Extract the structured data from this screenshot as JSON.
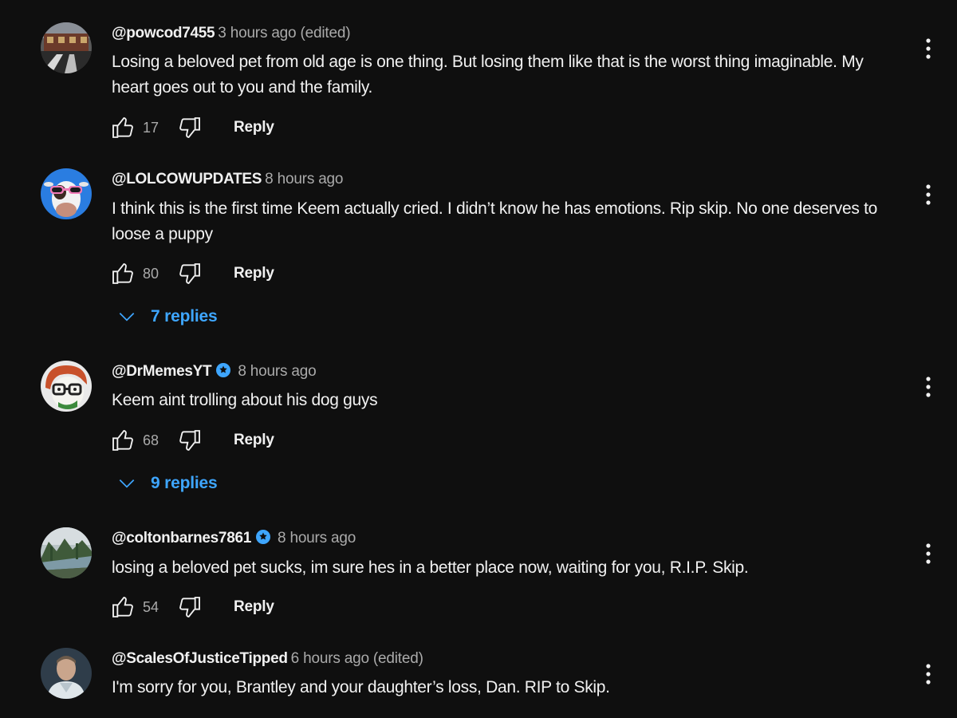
{
  "comments": [
    {
      "author": "@powcod7455",
      "verified": false,
      "timestamp": "3 hours ago (edited)",
      "text": "Losing a beloved pet from old age is one thing. But losing them like that is the worst thing imaginable. My heart goes out to you and the family.",
      "likes": "17",
      "reply_label": "Reply",
      "avatar_icon": "train-station-photo-avatar"
    },
    {
      "author": "@LOLCOWUPDATES",
      "verified": false,
      "timestamp": "8 hours ago",
      "text": "I think this is the first time Keem actually cried. I didn’t know he has emotions. Rip skip. No one deserves to loose a puppy",
      "likes": "80",
      "reply_label": "Reply",
      "replies_label": "7 replies",
      "avatar_icon": "cow-with-sunglasses-avatar"
    },
    {
      "author": "@DrMemesYT",
      "verified": true,
      "timestamp": "8 hours ago",
      "text": "Keem aint trolling about his dog guys",
      "likes": "68",
      "reply_label": "Reply",
      "replies_label": "9 replies",
      "avatar_icon": "cartoon-face-glasses-avatar"
    },
    {
      "author": "@coltonbarnes7861",
      "verified": true,
      "timestamp": "8 hours ago",
      "text": "losing a beloved pet sucks, im sure hes in a better place now, waiting for you, R.I.P. Skip.",
      "likes": "54",
      "reply_label": "Reply",
      "avatar_icon": "river-landscape-avatar"
    },
    {
      "author": "@ScalesOfJusticeTipped",
      "verified": false,
      "timestamp": "6 hours ago (edited)",
      "text": "I'm sorry for you, Brantley and your daughter’s loss, Dan. RIP to Skip.",
      "avatar_icon": "man-portrait-avatar"
    }
  ],
  "colors": {
    "background": "#0f0f0f",
    "text_primary": "#f1f1f1",
    "text_secondary": "#aaaaaa",
    "link_blue": "#3ea6ff",
    "verified_badge": "#3ea6ff"
  }
}
